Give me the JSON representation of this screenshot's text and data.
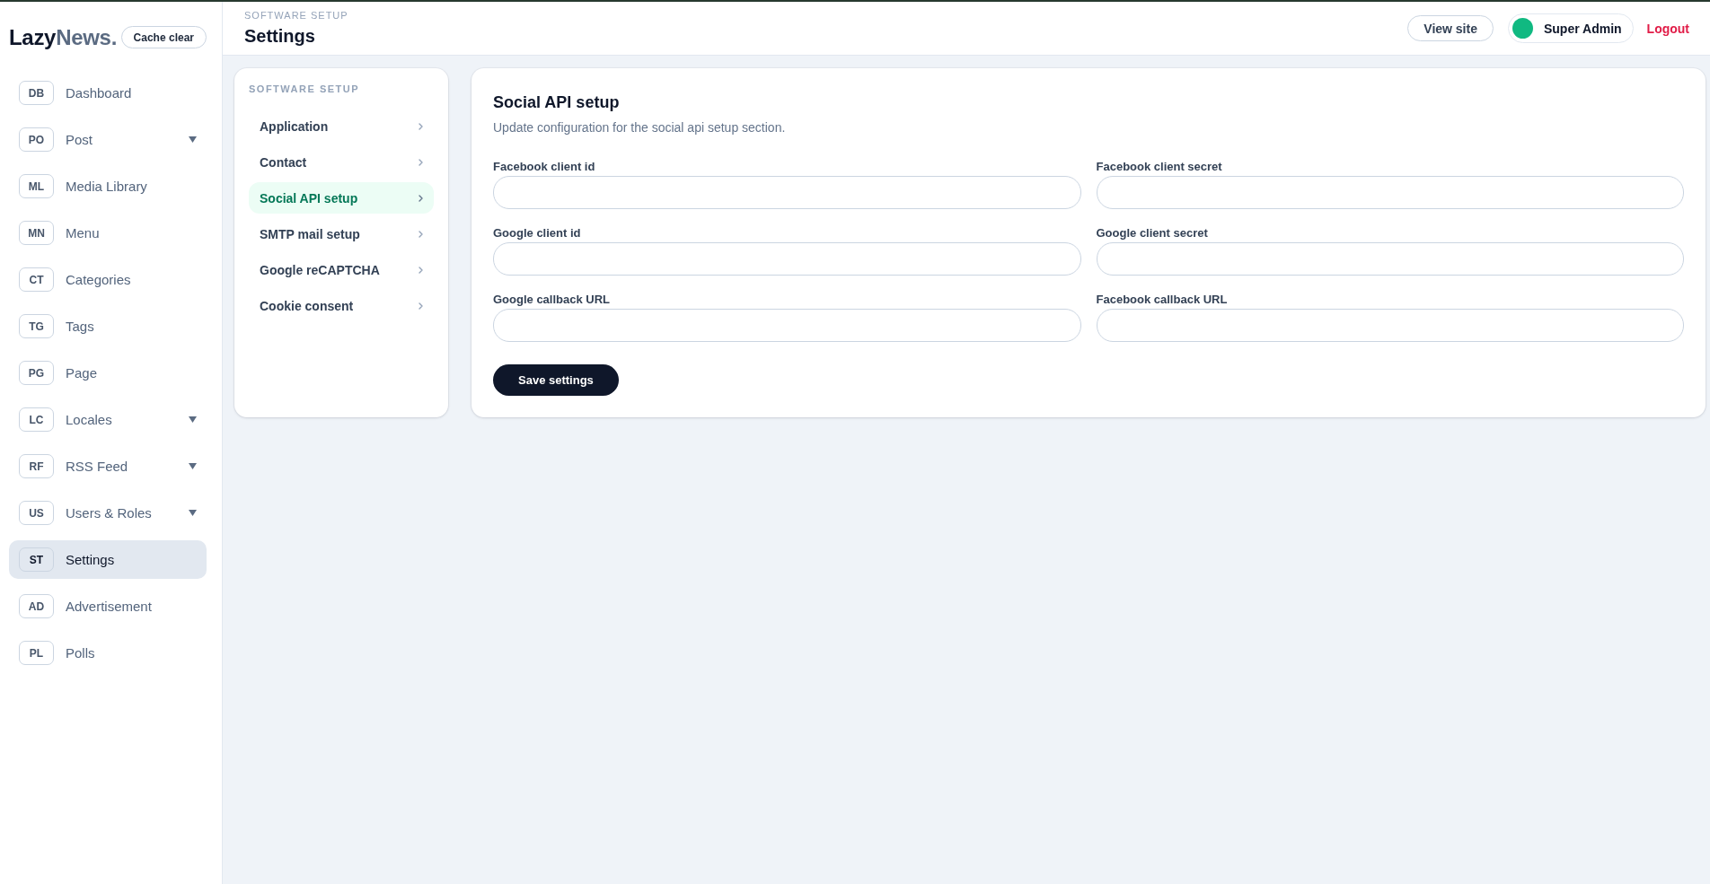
{
  "sidebar": {
    "logo": {
      "dark_part": "Lazy",
      "accent_part": "News."
    },
    "cache_button": "Cache clear",
    "items": [
      {
        "badge": "DB",
        "label": "Dashboard",
        "expandable": false,
        "selected": false
      },
      {
        "badge": "PO",
        "label": "Post",
        "expandable": true,
        "selected": false
      },
      {
        "badge": "ML",
        "label": "Media Library",
        "expandable": false,
        "selected": false
      },
      {
        "badge": "MN",
        "label": "Menu",
        "expandable": false,
        "selected": false
      },
      {
        "badge": "CT",
        "label": "Categories",
        "expandable": false,
        "selected": false
      },
      {
        "badge": "TG",
        "label": "Tags",
        "expandable": false,
        "selected": false
      },
      {
        "badge": "PG",
        "label": "Page",
        "expandable": false,
        "selected": false
      },
      {
        "badge": "LC",
        "label": "Locales",
        "expandable": true,
        "selected": false
      },
      {
        "badge": "RF",
        "label": "RSS Feed",
        "expandable": true,
        "selected": false
      },
      {
        "badge": "US",
        "label": "Users & Roles",
        "expandable": true,
        "selected": false
      },
      {
        "badge": "ST",
        "label": "Settings",
        "expandable": false,
        "selected": true
      },
      {
        "badge": "AD",
        "label": "Advertisement",
        "expandable": false,
        "selected": false
      },
      {
        "badge": "PL",
        "label": "Polls",
        "expandable": false,
        "selected": false
      }
    ]
  },
  "header": {
    "eyebrow": "SOFTWARE SETUP",
    "title": "Settings",
    "view_site_button": "View site",
    "user": {
      "name": "Super Admin"
    },
    "logout_link": "Logout"
  },
  "settings_nav": {
    "heading": "SOFTWARE SETUP",
    "items": [
      {
        "label": "Application",
        "selected": false
      },
      {
        "label": "Contact",
        "selected": false
      },
      {
        "label": "Social API setup",
        "selected": true
      },
      {
        "label": "SMTP mail setup",
        "selected": false
      },
      {
        "label": "Google reCAPTCHA",
        "selected": false
      },
      {
        "label": "Cookie consent",
        "selected": false
      }
    ]
  },
  "form": {
    "title": "Social API setup",
    "subtitle": "Update configuration for the social api setup section.",
    "fields": [
      {
        "label": "Facebook client id"
      },
      {
        "label": "Facebook client secret"
      },
      {
        "label": "Google client id"
      },
      {
        "label": "Google client secret"
      },
      {
        "label": "Google callback URL"
      },
      {
        "label": "Facebook callback URL"
      }
    ],
    "submit_button": "Save settings"
  }
}
